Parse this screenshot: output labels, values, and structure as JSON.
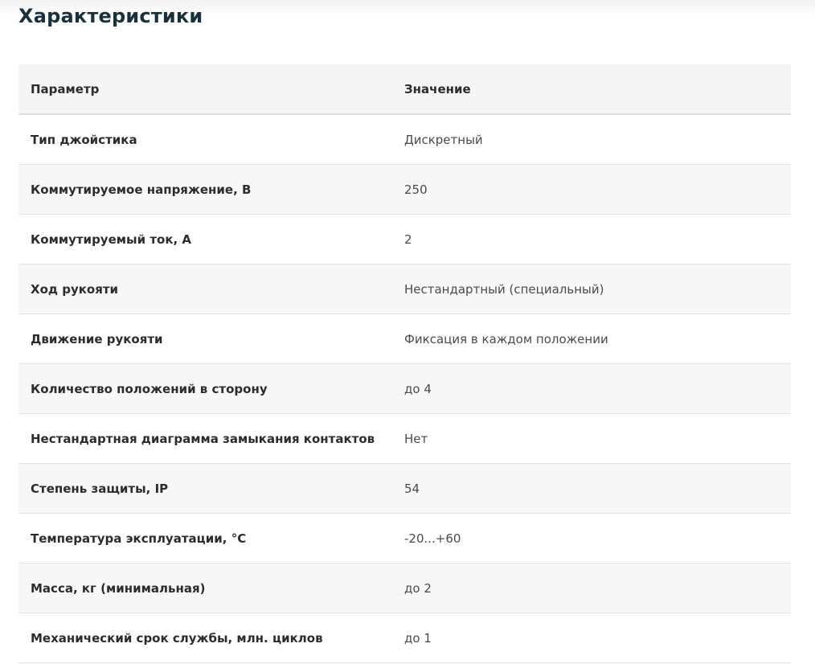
{
  "section": {
    "title": "Характеристики"
  },
  "table": {
    "headers": {
      "param": "Параметр",
      "value": "Значение"
    },
    "rows": [
      {
        "param": "Тип джойстика",
        "value": "Дискретный"
      },
      {
        "param": "Коммутируемое напряжение, В",
        "value": "250"
      },
      {
        "param": "Коммутируемый ток, А",
        "value": "2"
      },
      {
        "param": "Ход рукояти",
        "value": "Нестандартный (специальный)"
      },
      {
        "param": "Движение рукояти",
        "value": "Фиксация в каждом положении"
      },
      {
        "param": "Количество положений в сторону",
        "value": "до 4"
      },
      {
        "param": "Нестандартная диаграмма замыкания контактов",
        "value": "Нет"
      },
      {
        "param": "Степень защиты, IP",
        "value": "54"
      },
      {
        "param": "Температура эксплуатации, °С",
        "value": "-20...+60"
      },
      {
        "param": "Масса, кг (минимальная)",
        "value": "до 2"
      },
      {
        "param": "Механический срок службы, млн. циклов",
        "value": "до 1"
      }
    ]
  },
  "colors": {
    "title": "#16323f",
    "header_bg": "#f5f5f5",
    "row_alt_bg": "#f7f7f7",
    "border": "#e2e2e2"
  }
}
